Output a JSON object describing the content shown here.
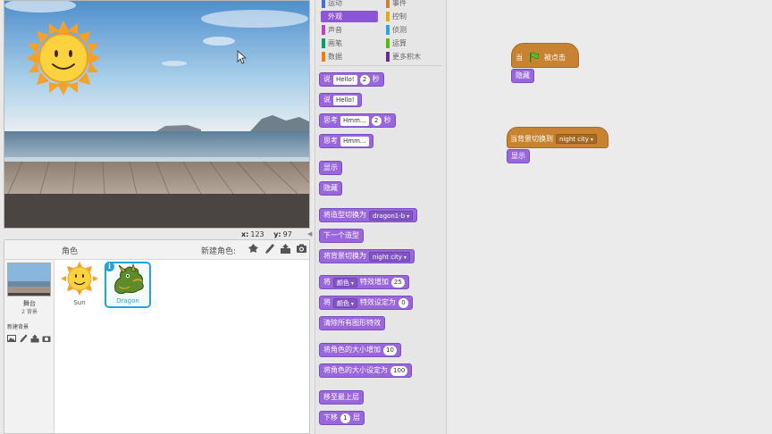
{
  "stage": {
    "coord_x_label": "x:",
    "coord_x_value": "123",
    "coord_y_label": "y:",
    "coord_y_value": "97"
  },
  "sprite_pane": {
    "label": "角色",
    "new_sprite_label": "新建角色:",
    "stage_name": "舞台",
    "stage_backdrop_count": "2 背景",
    "new_backdrop_label": "新建背景",
    "sprites": [
      {
        "name": "Sun"
      },
      {
        "name": "Dragon"
      }
    ]
  },
  "palette": {
    "categories_left": [
      "运动",
      "外观",
      "声音",
      "画笔",
      "数据"
    ],
    "categories_right": [
      "事件",
      "控制",
      "侦测",
      "运算",
      "更多积木"
    ],
    "category_colors_left": [
      "#4a6cd4",
      "#8a55d7",
      "#bb42c3",
      "#0e9a6c",
      "#ee7d16"
    ],
    "category_colors_right": [
      "#c88330",
      "#e1a91a",
      "#2ca5e2",
      "#5cb712",
      "#632d99"
    ],
    "active_category": "外观",
    "blocks": {
      "say_secs": {
        "label": "说",
        "text": "Hello!",
        "secs": "2",
        "unit": "秒"
      },
      "say": {
        "label": "说",
        "text": "Hello!"
      },
      "think_secs": {
        "label": "思考",
        "text": "Hmm...",
        "secs": "2",
        "unit": "秒"
      },
      "think": {
        "label": "思考",
        "text": "Hmm..."
      },
      "show": "显示",
      "hide": "隐藏",
      "switch_costume": {
        "label": "将造型切换为",
        "value": "dragon1-b"
      },
      "next_costume": "下一个造型",
      "switch_backdrop": {
        "label": "将背景切换为",
        "value": "night city"
      },
      "change_effect": {
        "prefix": "将",
        "effect": "颜色",
        "label": "特效增加",
        "value": "25"
      },
      "set_effect": {
        "prefix": "将",
        "effect": "颜色",
        "label": "特效设定为",
        "value": "0"
      },
      "clear_effects": "清除所有图形特效",
      "change_size": {
        "label": "将角色的大小增加",
        "value": "10"
      },
      "set_size": {
        "label": "将角色的大小设定为",
        "value": "100"
      },
      "go_front": "移至最上层",
      "go_back": {
        "label": "下移",
        "value": "1",
        "unit": "层"
      }
    }
  },
  "scripts": {
    "when_flag": {
      "prefix": "当",
      "suffix": "被点击"
    },
    "hide": "隐藏",
    "when_backdrop": {
      "label": "当背景切换到",
      "value": "night city"
    },
    "show": "显示"
  }
}
